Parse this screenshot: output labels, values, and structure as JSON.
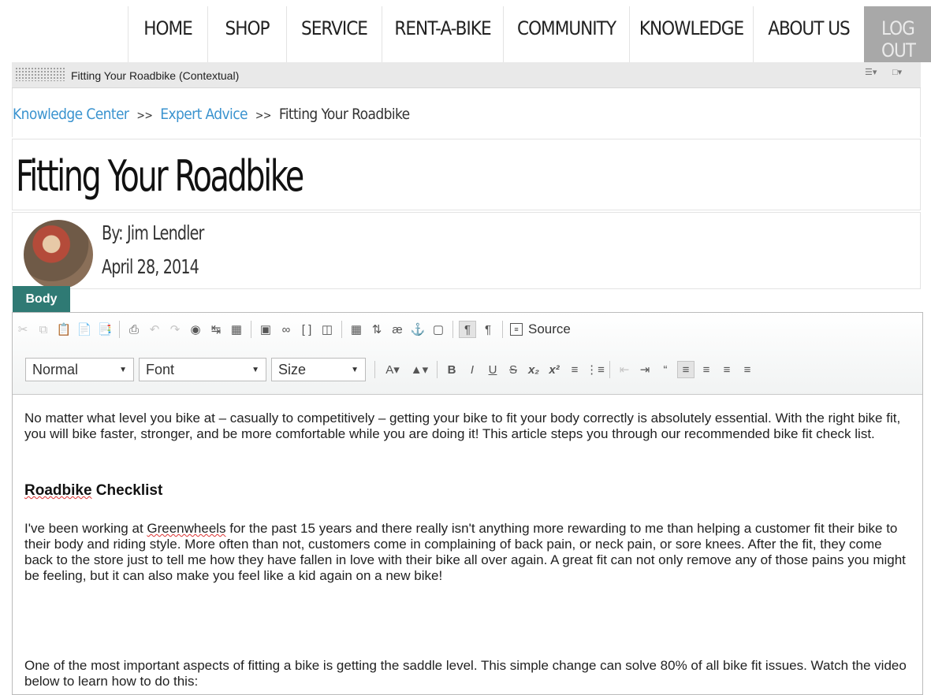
{
  "nav": {
    "items": [
      "HOME",
      "SHOP",
      "SERVICE",
      "RENT-A-BIKE",
      "COMMUNITY",
      "KNOWLEDGE",
      "ABOUT US"
    ],
    "logout": "LOG OUT"
  },
  "context_bar": {
    "title": "Fitting Your Roadbike (Contextual)"
  },
  "breadcrumb": {
    "items": [
      "Knowledge Center",
      "Expert Advice",
      "Fitting Your Roadbike"
    ],
    "separator": ">>"
  },
  "page": {
    "title": "Fitting Your Roadbike",
    "author": "By: Jim Lendler",
    "date": "April 28, 2014",
    "body_tab": "Body"
  },
  "toolbar": {
    "source_label": "Source",
    "format_select": "Normal",
    "font_select": "Font",
    "size_select": "Size"
  },
  "content": {
    "p1": "No matter what level you bike at – casually to competitively – getting your bike to fit your body correctly is absolutely essential. With the right bike fit, you will bike faster, stronger, and be more comfortable while you are doing it! This article steps you through our recommended bike fit check list.",
    "heading_word": "Roadbike",
    "heading_rest": " Checklist",
    "p2_before": "I've been working at ",
    "p2_link": "Greenwheels",
    "p2_after": " for the past 15 years and there really isn't anything more rewarding to me than helping a customer fit their bike to their body and riding style. More often than not, customers come in complaining of back pain, or neck pain, or sore knees. After the fit, they come back to the store just to tell me how they have fallen in love with their bike all over again. A great fit can not only remove any of those pains you might be feeling, but it can also make you feel like a kid again on a new bike!",
    "p3": "One of the most important aspects of fitting a bike is getting the saddle level. This simple change can solve 80% of all bike fit issues. Watch the video below to learn how to do this:"
  }
}
